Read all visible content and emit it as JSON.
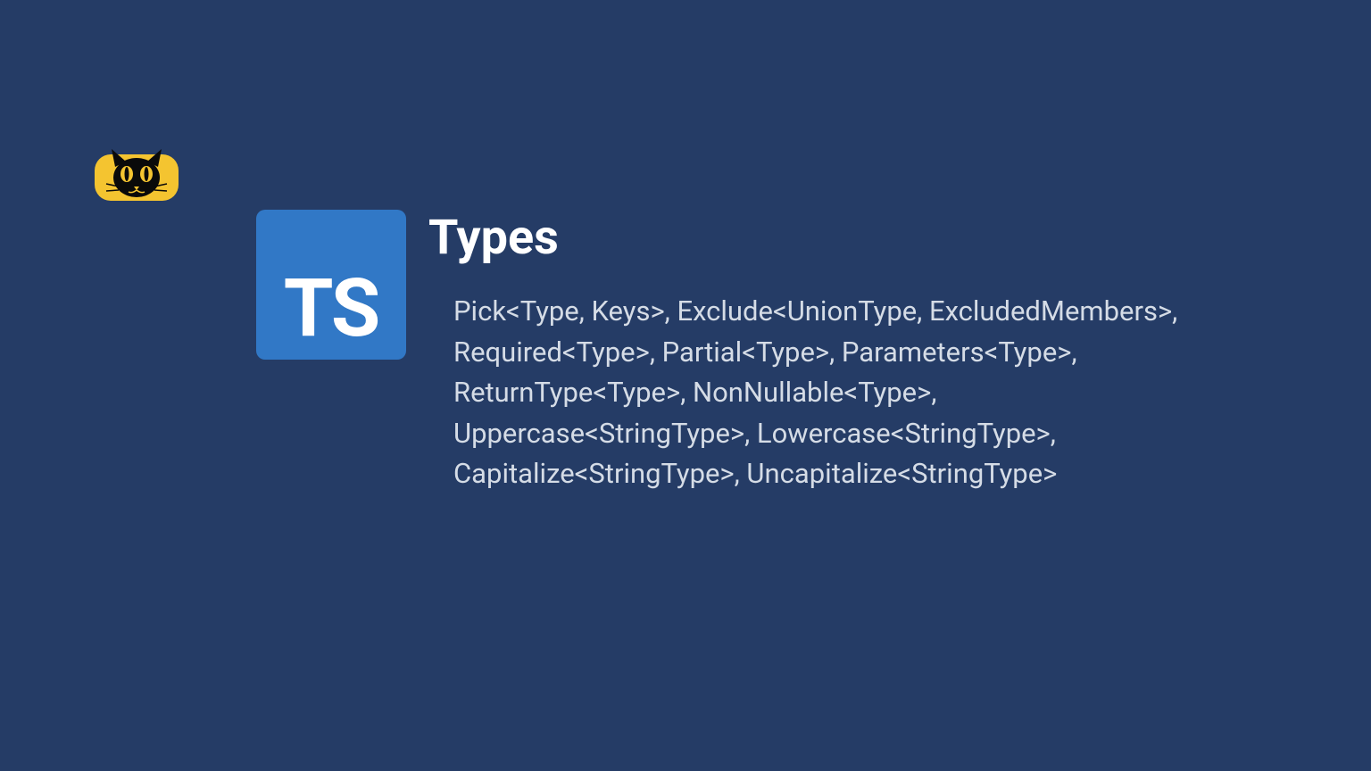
{
  "logo": {
    "ts_label": "TS"
  },
  "content": {
    "title": "Types",
    "body": "Pick<Type, Keys>, Exclude<UnionType, ExcludedMembers>, Required<Type>, Partial<Type>, Parameters<Type>, ReturnType<Type>, NonNullable<Type>, Uppercase<StringType>, Lowercase<StringType>, Capitalize<StringType>, Uncapitalize<StringType>"
  }
}
